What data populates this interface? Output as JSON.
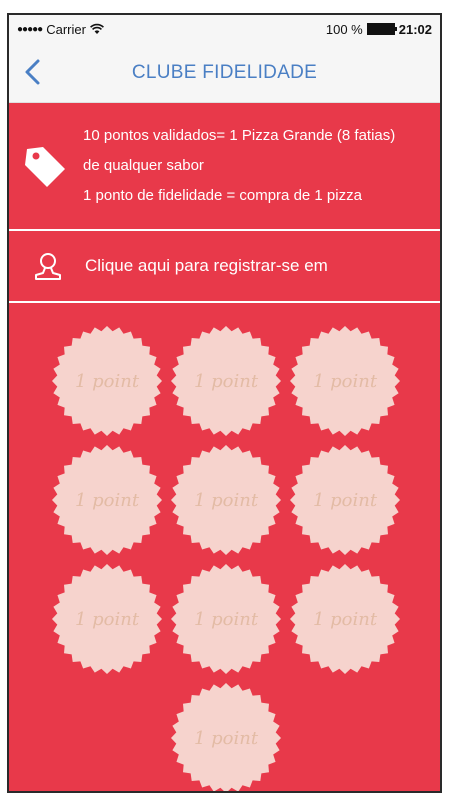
{
  "status_bar": {
    "signal": "●●●●●",
    "carrier": "Carrier",
    "battery_pct": "100 %",
    "time": "21:02"
  },
  "nav": {
    "title": "CLUBE FIDELIDADE",
    "back_icon": "chevron-left-icon"
  },
  "info": {
    "icon": "tag-icon",
    "line1": "10 pontos validados= 1 Pizza Grande (8 fatias)",
    "line2": "de qualquer sabor",
    "line3": "1 ponto de fidelidade = compra de 1 pizza"
  },
  "register": {
    "icon": "user-icon",
    "label": "Clique aqui para registrar-se em"
  },
  "points": [
    {
      "label": "1 point"
    },
    {
      "label": "1 point"
    },
    {
      "label": "1 point"
    },
    {
      "label": "1 point"
    },
    {
      "label": "1 point"
    },
    {
      "label": "1 point"
    },
    {
      "label": "1 point"
    },
    {
      "label": "1 point"
    },
    {
      "label": "1 point"
    },
    {
      "label": "1 point"
    }
  ],
  "colors": {
    "accent": "#e8394a",
    "nav_title": "#4a7fc4",
    "stamp_fill": "#f6d3cd",
    "stamp_text": "#e3bba5"
  }
}
